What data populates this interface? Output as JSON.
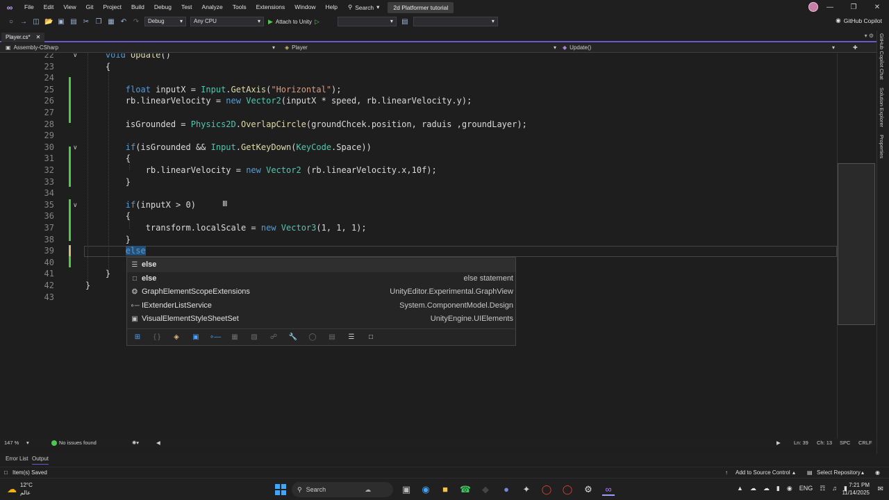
{
  "menubar": {
    "items": [
      "File",
      "Edit",
      "View",
      "Git",
      "Project",
      "Build",
      "Debug",
      "Test",
      "Analyze",
      "Tools",
      "Extensions",
      "Window",
      "Help"
    ],
    "search_label": "Search",
    "solution_title": "2d Platformer tutorial",
    "window_controls": [
      "—",
      "❐",
      "✕"
    ]
  },
  "toolbar": {
    "config": "Debug",
    "platform": "Any CPU",
    "attach_label": "Attach to Unity",
    "copilot_label": "GitHub Copilot"
  },
  "tab": {
    "label": "Player.cs*",
    "close": "✕",
    "overflow": "▾ ⚙"
  },
  "navbar": {
    "project": "Assembly-CSharp",
    "class": "Player",
    "member": "Update()"
  },
  "editor": {
    "lines": [
      {
        "no": "22",
        "html": "    <span class=\"kw\">void</span> <span class=\"fn\">Update</span>()"
      },
      {
        "no": "23",
        "html": "    {"
      },
      {
        "no": "24",
        "html": ""
      },
      {
        "no": "25",
        "html": "        <span class=\"kw\">float</span> inputX = <span class=\"ty\">Input</span>.<span class=\"fn\">GetAxis</span>(<span class=\"st\">\"Horizontal\"</span>);"
      },
      {
        "no": "26",
        "html": "        rb.linearVelocity = <span class=\"kw\">new</span> <span class=\"ty\">Vector2</span>(inputX * speed, rb.linearVelocity.y);"
      },
      {
        "no": "27",
        "html": ""
      },
      {
        "no": "28",
        "html": "        isGrounded = <span class=\"ty\">Physics2D</span>.<span class=\"fn\">OverlapCircle</span>(groundChcek.position, raduis ,groundLayer);"
      },
      {
        "no": "29",
        "html": ""
      },
      {
        "no": "30",
        "html": "        <span class=\"kw\">if</span>(isGrounded &amp;&amp; <span class=\"ty\">Input</span>.<span class=\"fn\">GetKeyDown</span>(<span class=\"ty\">KeyCode</span>.Space))"
      },
      {
        "no": "31",
        "html": "        {"
      },
      {
        "no": "32",
        "html": "            rb.linearVelocity = <span class=\"kw\">new</span> <span class=\"ty\">Vector2</span> (rb.linearVelocity.x,10f);"
      },
      {
        "no": "33",
        "html": "        }"
      },
      {
        "no": "34",
        "html": ""
      },
      {
        "no": "35",
        "html": "        <span class=\"kw\">if</span>(inputX &gt; 0)"
      },
      {
        "no": "36",
        "html": "        {"
      },
      {
        "no": "37",
        "html": "            transform.localScale = <span class=\"kw\">new</span> <span class=\"ty\">Vector3</span>(1, 1, 1);"
      },
      {
        "no": "38",
        "html": "        }"
      },
      {
        "no": "39",
        "html": "        <span id=\"caret-sel\" class=\"kw\">else</span>"
      },
      {
        "no": "40",
        "html": ""
      },
      {
        "no": "41",
        "html": "    }"
      },
      {
        "no": "42",
        "html": "}"
      },
      {
        "no": "43",
        "html": ""
      }
    ]
  },
  "completion": {
    "items": [
      {
        "icon": "☰",
        "label": "else",
        "desc": "",
        "selected": true
      },
      {
        "icon": "□",
        "label": "else",
        "desc": "else statement"
      },
      {
        "icon": "❂",
        "label": "GraphElementScopeExtensions",
        "desc": "UnityEditor.Experimental.GraphView"
      },
      {
        "icon": "∘─",
        "label": "IExtenderListService",
        "desc": "System.ComponentModel.Design"
      },
      {
        "icon": "▣",
        "label": "VisualElementStyleSheetSet",
        "desc": "UnityEngine.UIElements"
      }
    ]
  },
  "right_rail": {
    "labels": [
      "GitHub Copilot Chat",
      "Solution Explorer",
      "Properties"
    ]
  },
  "edstatus": {
    "zoom": "147 %",
    "issues": "No issues found",
    "ln": "Ln: 39",
    "ch": "Ch: 13",
    "spc": "SPC",
    "crlf": "CRLF"
  },
  "bottom_tabs": {
    "error_list": "Error List",
    "output": "Output"
  },
  "statusbar": {
    "saved": "Item(s) Saved",
    "source_control": "Add to Source Control",
    "repository": "Select Repository"
  },
  "taskbar": {
    "temp": "12°C",
    "weather_sub": "عالم",
    "search": "Search",
    "lang": "ENG",
    "time": "7:21 PM",
    "date": "11/14/2025"
  },
  "colors": {
    "accent": "#6a5acd",
    "keyword": "#569cd6",
    "type": "#4ec9b0",
    "string": "#d69d85",
    "added": "#4ec94e"
  }
}
